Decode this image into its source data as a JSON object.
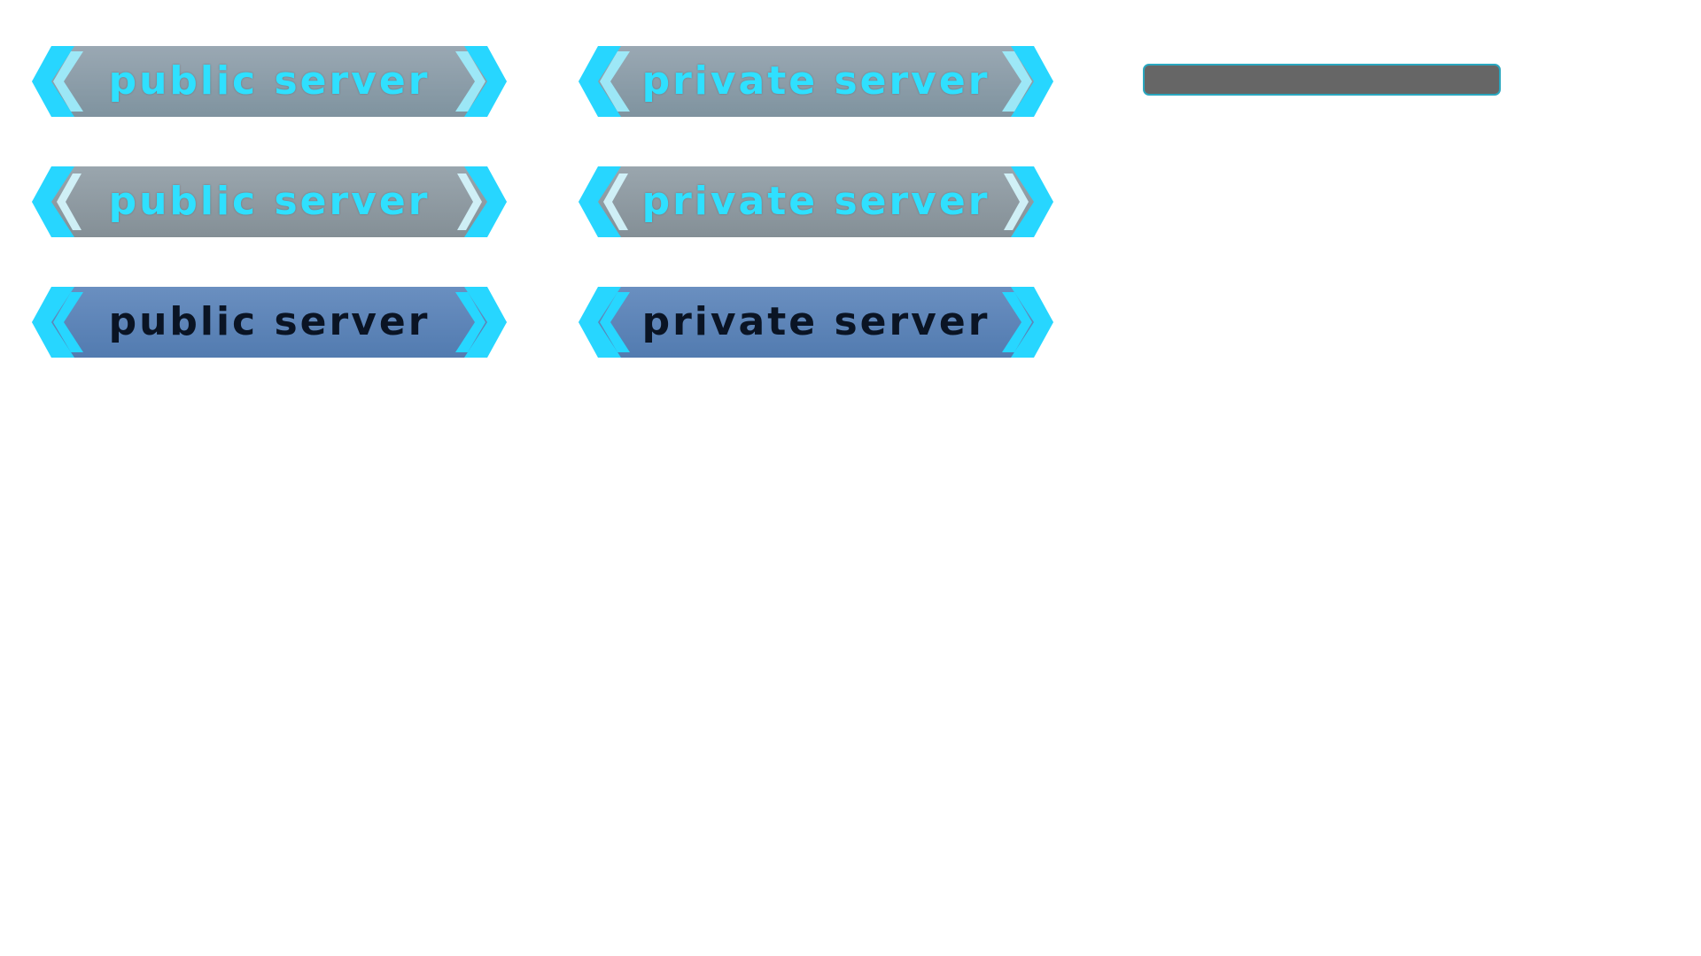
{
  "buttons": {
    "public": {
      "label": "PUBLIC SERVER"
    },
    "private": {
      "label": "PRIVATE SERVER"
    }
  },
  "states": [
    {
      "name": "normal",
      "text_color": "#2fe0ff",
      "fill_top": "#9aa8b3",
      "fill_bottom": "#7f939f"
    },
    {
      "name": "hover",
      "text_color": "#2fe0ff",
      "fill_top": "#9aa6ae",
      "fill_bottom": "#848f96"
    },
    {
      "name": "pressed",
      "text_color": "#0a1424",
      "fill_top": "#6a8fc0",
      "fill_bottom": "#527bb0"
    }
  ],
  "colors": {
    "accent_cyan": "#27d6ff",
    "accent_cyan_light": "#9ff0ff",
    "progress_track": "#666666",
    "progress_border": "#2aa7bf"
  },
  "progress": {
    "fraction": 0
  }
}
